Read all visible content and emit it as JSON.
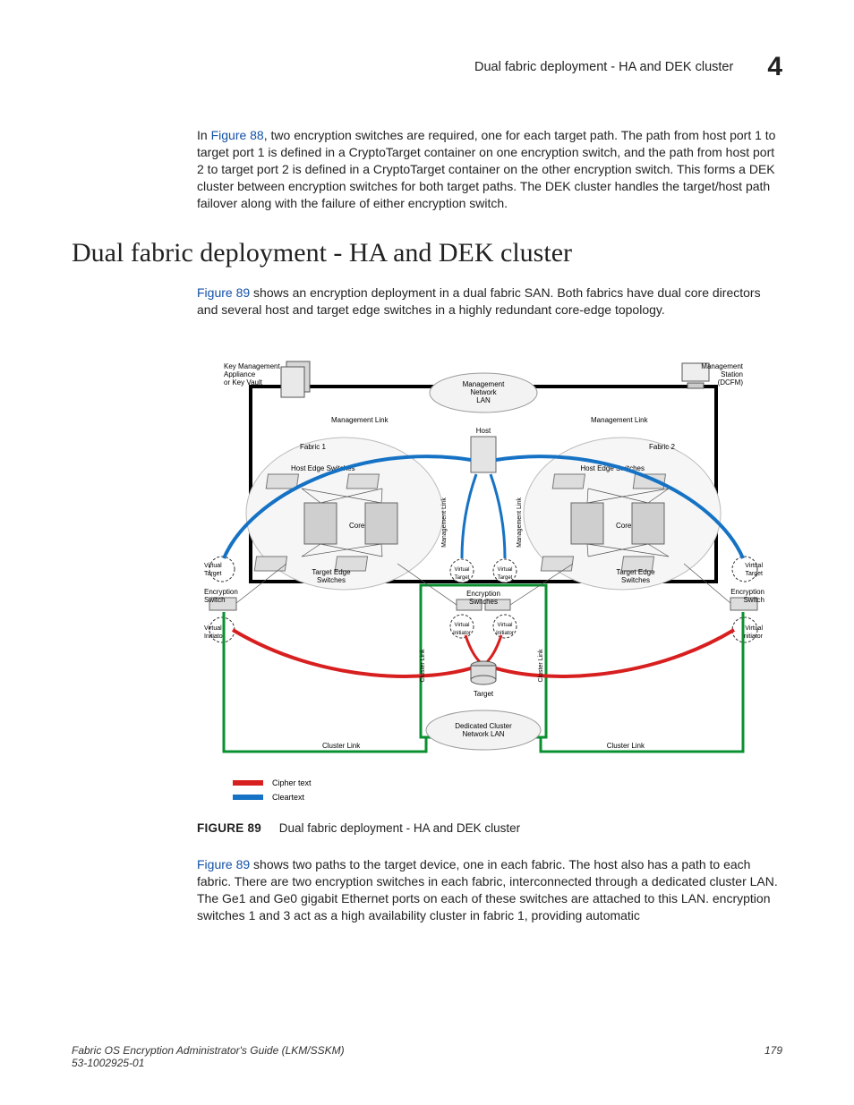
{
  "header": {
    "title": "Dual fabric deployment - HA and DEK cluster",
    "chapter": "4"
  },
  "para1": {
    "prefix": "In ",
    "xref": "Figure 88",
    "rest": ", two encryption switches are required, one for each target path. The path from host port 1 to target port 1 is defined in a CryptoTarget container on one encryption switch, and the path from host port 2 to target port 2 is defined in a CryptoTarget container on the other encryption switch. This forms a DEK cluster between encryption switches for both target paths. The DEK cluster handles the target/host path failover along with the failure of either encryption switch."
  },
  "heading": "Dual fabric deployment - HA and DEK cluster",
  "para2": {
    "xref": "Figure 89",
    "rest": " shows an encryption deployment in a dual fabric SAN. Both fabrics have dual core directors and several host and target edge switches in a highly redundant core-edge topology."
  },
  "diagram": {
    "key_vault": "Key Management\nAppliance\nor Key Vault",
    "mgmt_station": "Management\nStation\n(DCFM)",
    "mgmt_lan": "Management\nNetwork\nLAN",
    "mgmt_link_left": "Management Link",
    "mgmt_link_right": "Management Link",
    "mgmt_link_vL": "Management Link",
    "mgmt_link_vR": "Management Link",
    "host": "Host",
    "fabric1": "Fabric 1",
    "fabric2": "Fabric 2",
    "host_edge_L": "Host Edge Switches",
    "host_edge_R": "Host Edge Switches",
    "core_L": "Core",
    "core_R": "Core",
    "target_edge_L": "Target Edge\nSwitches",
    "target_edge_R": "Target Edge\nSwitches",
    "vtargetL": "Virtual\nTarget",
    "vtargetR": "Virtual\nTarget",
    "vtargetML": "Virtual\nTarget",
    "vtargetMR": "Virtual\nTarget",
    "vinitL": "Virtual\nInitiator",
    "vinitR": "Virtual\nInitiator",
    "vinitML": "Virtual\nInitiator",
    "vinitMR": "Virtual\nInitiator",
    "enc_sw_L": "Encryption\nSwitch",
    "enc_sw_R": "Encryption\nSwitch",
    "enc_sw_M": "Encryption\nSwitches",
    "target": "Target",
    "cluster_lan": "Dedicated Cluster\nNetwork LAN",
    "cluster_link_L": "Cluster Link",
    "cluster_link_R": "Cluster Link",
    "cluster_link_vL": "Cluster Link",
    "cluster_link_vR": "Cluster Link",
    "legend_cipher": "Cipher text",
    "legend_clear": "Cleartext"
  },
  "figcap": {
    "label": "FIGURE 89",
    "text": "Dual fabric deployment - HA and DEK cluster"
  },
  "para3": {
    "xref": "Figure 89",
    "rest": " shows two paths to the target device, one in each fabric. The host also has a path to each fabric. There are two encryption switches in each fabric, interconnected through a dedicated cluster LAN. The Ge1 and Ge0 gigabit Ethernet ports on each of these switches are attached to this LAN. encryption switches 1 and 3 act as a high availability cluster in fabric 1, providing automatic"
  },
  "footer": {
    "book": "Fabric OS Encryption Administrator's Guide  (LKM/SSKM)",
    "partno": "53-1002925-01",
    "page": "179"
  }
}
